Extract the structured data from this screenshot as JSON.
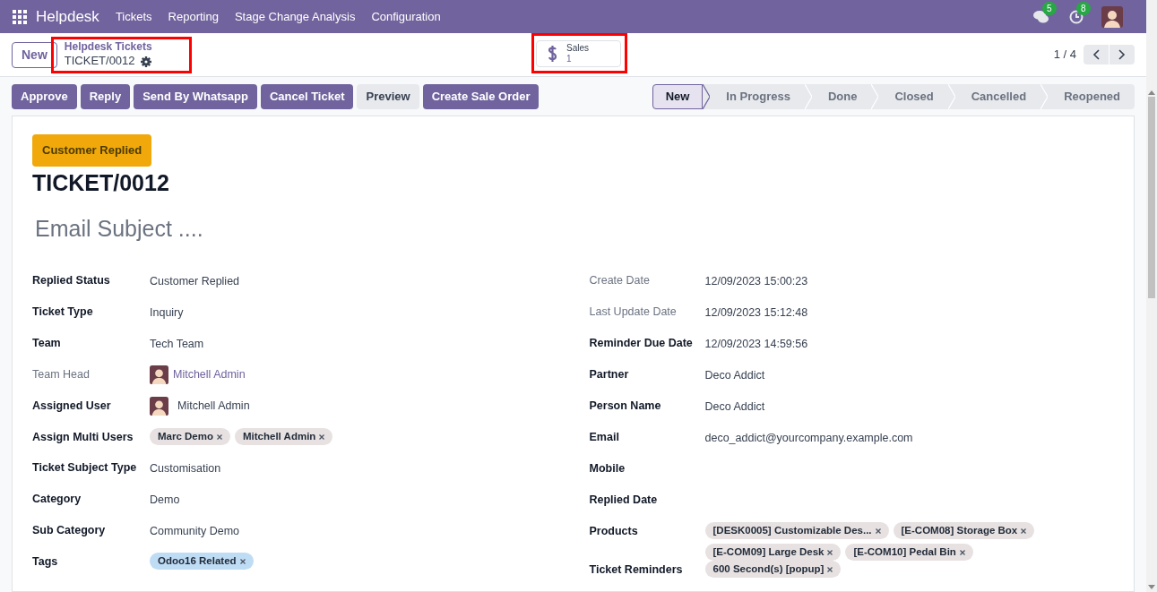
{
  "navbar": {
    "app": "Helpdesk",
    "menus": [
      "Tickets",
      "Reporting",
      "Stage Change Analysis",
      "Configuration"
    ],
    "messages_badge": "5",
    "activities_badge": "8"
  },
  "control_panel": {
    "new_button": "New",
    "breadcrumb": "Helpdesk Tickets",
    "record": "TICKET/0012",
    "smart_button": {
      "label": "Sales",
      "value": "1"
    },
    "pager": "1 / 4"
  },
  "actions": [
    {
      "label": "Approve",
      "kind": "primary"
    },
    {
      "label": "Reply",
      "kind": "primary"
    },
    {
      "label": "Send By Whatsapp",
      "kind": "primary"
    },
    {
      "label": "Cancel Ticket",
      "kind": "primary"
    },
    {
      "label": "Preview",
      "kind": "secondary"
    },
    {
      "label": "Create Sale Order",
      "kind": "primary"
    }
  ],
  "stages": [
    {
      "label": "New",
      "selected": true
    },
    {
      "label": "In Progress",
      "selected": false
    },
    {
      "label": "Done",
      "selected": false
    },
    {
      "label": "Closed",
      "selected": false
    },
    {
      "label": "Cancelled",
      "selected": false
    },
    {
      "label": "Reopened",
      "selected": false
    }
  ],
  "ribbon": "Customer Replied",
  "title": "TICKET/0012",
  "subject_placeholder": "Email Subject ....",
  "left_fields": [
    {
      "label": "Replied Status",
      "readonly": false,
      "kind": "text",
      "value": "Customer Replied"
    },
    {
      "label": "Ticket Type",
      "readonly": false,
      "kind": "text",
      "value": "Inquiry"
    },
    {
      "label": "Team",
      "readonly": false,
      "kind": "text",
      "value": "Tech Team"
    },
    {
      "label": "Team Head",
      "readonly": true,
      "kind": "user",
      "link": true,
      "value": "Mitchell Admin"
    },
    {
      "label": "Assigned User",
      "readonly": false,
      "kind": "user",
      "link": false,
      "value": "Mitchell Admin"
    },
    {
      "label": "Assign Multi Users",
      "readonly": false,
      "kind": "tags",
      "tags": [
        {
          "label": "Marc Demo",
          "color": "#e7e1e1"
        },
        {
          "label": "Mitchell Admin",
          "color": "#e7e1e1"
        }
      ]
    },
    {
      "label": "Ticket Subject Type",
      "readonly": false,
      "kind": "text",
      "value": "Customisation"
    },
    {
      "label": "Category",
      "readonly": false,
      "kind": "text",
      "value": "Demo"
    },
    {
      "label": "Sub Category",
      "readonly": false,
      "kind": "text",
      "value": "Community Demo"
    },
    {
      "label": "Tags",
      "readonly": false,
      "kind": "tags",
      "tags": [
        {
          "label": "Odoo16 Related",
          "color": "#bfdcf5"
        }
      ]
    }
  ],
  "right_fields": [
    {
      "label": "Create Date",
      "readonly": true,
      "kind": "text",
      "value": "12/09/2023 15:00:23"
    },
    {
      "label": "Last Update Date",
      "readonly": true,
      "kind": "text",
      "value": "12/09/2023 15:12:48"
    },
    {
      "label": "Reminder Due Date",
      "readonly": false,
      "kind": "text",
      "value": "12/09/2023 14:59:56"
    },
    {
      "label": "Partner",
      "readonly": false,
      "kind": "text",
      "value": "Deco Addict"
    },
    {
      "label": "Person Name",
      "readonly": false,
      "kind": "text",
      "value": "Deco Addict"
    },
    {
      "label": "Email",
      "readonly": false,
      "kind": "text",
      "value": "deco_addict@yourcompany.example.com"
    },
    {
      "label": "Mobile",
      "readonly": false,
      "kind": "empty"
    },
    {
      "label": "Replied Date",
      "readonly": false,
      "kind": "empty"
    },
    {
      "label": "Products",
      "readonly": false,
      "kind": "tags",
      "tags": [
        {
          "label": "[DESK0005] Customizable Des...",
          "color": "#e7e1e1"
        },
        {
          "label": "[E-COM08] Storage Box",
          "color": "#e7e1e1"
        },
        {
          "label": "[E-COM09] Large Desk",
          "color": "#e7e1e1"
        },
        {
          "label": "[E-COM10] Pedal Bin",
          "color": "#e7e1e1"
        }
      ]
    },
    {
      "label": "Ticket Reminders",
      "readonly": false,
      "kind": "tags",
      "tags": [
        {
          "label": "600 Second(s) [popup]",
          "color": "#e7e1e1"
        }
      ]
    }
  ]
}
